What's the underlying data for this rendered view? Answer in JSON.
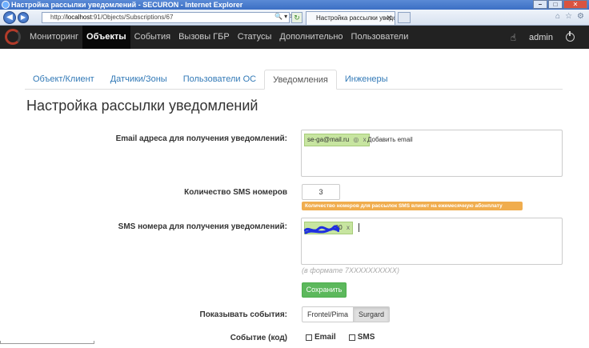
{
  "window": {
    "title": "Настройка рассылки уведомлений - SECURON - Internet Explorer",
    "controls": {
      "minimize": "–",
      "maximize": "□",
      "close": "✕"
    }
  },
  "browser": {
    "back": "◀",
    "forward": "▶",
    "address_prefix": "http://",
    "address_host": "localhost",
    "address_rest": ":91/Objects/Subscriptions/67",
    "address_tools": "🔍 ▾ ✕",
    "refresh": "↻",
    "tab_title": "Настройка рассылки уведо...",
    "tab_close": "✕",
    "right_icons": [
      "⌂",
      "☆",
      "⚙"
    ]
  },
  "navbar": {
    "items": [
      "Мониторинг",
      "Объекты",
      "События",
      "Вызовы ГБР",
      "Статусы",
      "Дополнительно",
      "Пользователи"
    ],
    "active_index": 1,
    "user": "admin"
  },
  "tabs": {
    "items": [
      "Объект/Клиент",
      "Датчики/Зоны",
      "Пользователи ОС",
      "Уведомления",
      "Инженеры"
    ],
    "active_index": 3
  },
  "page": {
    "title": "Настройка рассылки уведомлений"
  },
  "form": {
    "email_label": "Email адреса для получения уведомлений:",
    "email_tags": [
      {
        "value": "se-ga@mail.ru",
        "mark": "◎",
        "remove": "x"
      }
    ],
    "email_add_placeholder": "Добавить email",
    "sms_count_label": "Количество SMS номеров",
    "sms_count_value": "3",
    "sms_count_hint": "Количество номеров для рассылок SMS влияет на ежемесячную абонплату",
    "sms_label": "SMS номера для получения уведомлений:",
    "sms_tag_suffix": "00",
    "sms_tag_remove": "x",
    "sms_format_hint": "(в формате 7XXXXXXXXXX)",
    "save_label": "Сохранить",
    "show_events_label": "Показывать события:",
    "show_events_options": [
      "Frontel/Pima",
      "Surgard"
    ],
    "show_events_selected": "Surgard",
    "event_code_label": "Событие (код)",
    "event_channels": [
      "Email",
      "SMS"
    ]
  },
  "colors": {
    "navbar_bg": "#222222",
    "link": "#337ab7",
    "tag_bg": "#c7e5a0",
    "warning": "#f0ad4e",
    "success": "#5cb85c",
    "redaction": "#1f2fe0"
  }
}
